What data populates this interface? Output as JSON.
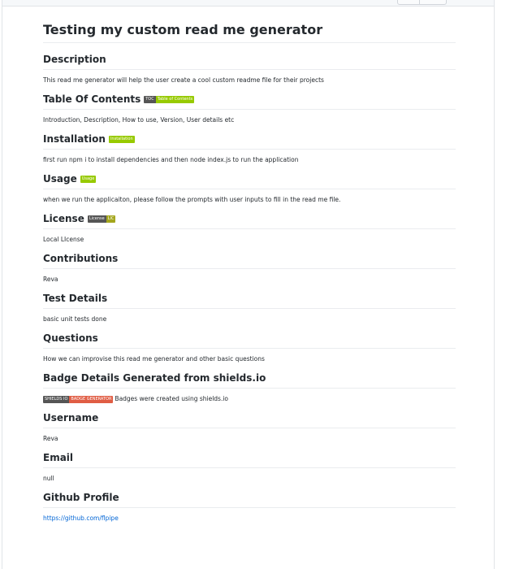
{
  "title": "Testing my custom read me generator",
  "sections": {
    "description": {
      "heading": "Description",
      "text": "This read me generator will help the user create a cool custom readme file for their projects"
    },
    "toc": {
      "heading": "Table Of Contents",
      "badge_left": "TOC",
      "badge_right": "Table of Contents",
      "text": "Introduction, Description, How to use, Version, User details etc"
    },
    "installation": {
      "heading": "Installation",
      "badge_right": "Installation",
      "text": "first run npm i to install dependencies and then node index.js to run the application"
    },
    "usage": {
      "heading": "Usage",
      "badge_right": "Usage",
      "text": "when we run the applicaiton, please follow the prompts with user inputs to fill in the read me file."
    },
    "license": {
      "heading": "License",
      "badge_left": "License",
      "badge_right": "LIC",
      "text": "Local LIcense"
    },
    "contributions": {
      "heading": "Contributions",
      "text": "Reva"
    },
    "tests": {
      "heading": "Test Details",
      "text": "basic unit tests done"
    },
    "questions": {
      "heading": "Questions",
      "text": "How we can improvise this read me generator and other basic questions"
    },
    "badges": {
      "heading": "Badge Details Generated from shields.io",
      "badge_left": "SHIELDS IO",
      "badge_right": "BADGE GENERATOR",
      "text": "Badges were created using shields.io"
    },
    "username": {
      "heading": "Username",
      "text": "Reva"
    },
    "email": {
      "heading": "Email",
      "text": "null"
    },
    "github": {
      "heading": "Github Profile",
      "link": "https://github.com/flpipe"
    }
  },
  "colors": {
    "link": "#0366d6",
    "badge_label": "#555555",
    "badge_green": "#97ca00",
    "badge_olive": "#a4a61d",
    "badge_red": "#e05d44"
  }
}
